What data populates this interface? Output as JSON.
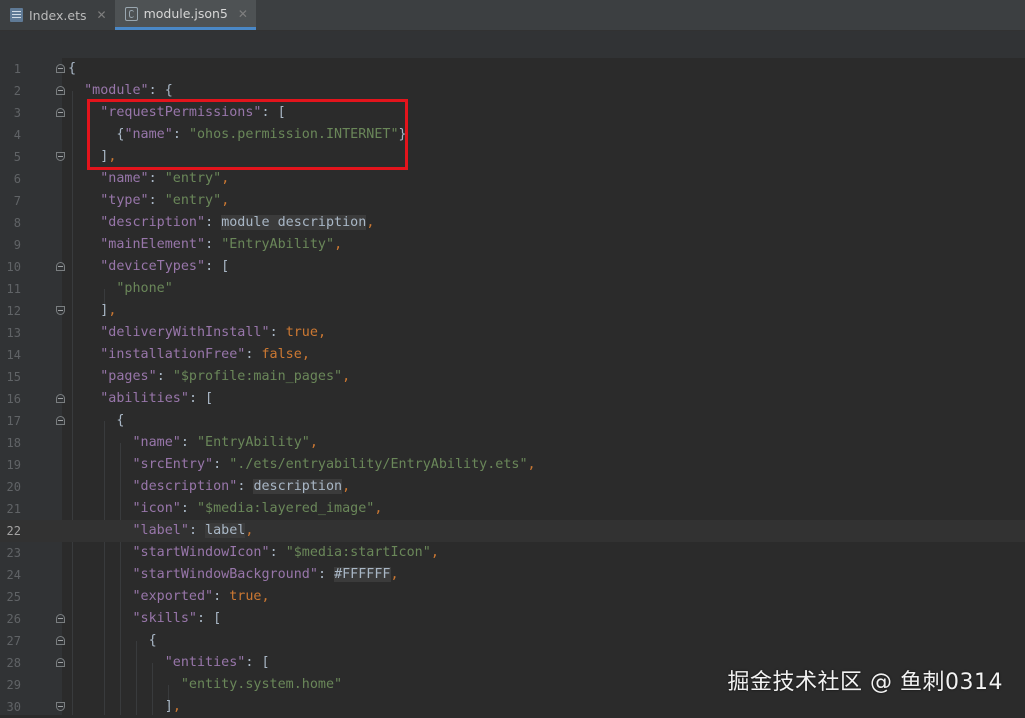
{
  "tabs": [
    {
      "label": "Index.ets",
      "icon": "ets-file-icon",
      "active": false
    },
    {
      "label": "module.json5",
      "icon": "json-file-icon",
      "active": true
    }
  ],
  "tab_close_glyph": "✕",
  "current_line": 22,
  "watermark": "掘金技术社区 @ 鱼刺0314",
  "highlight_color": "#e3141c",
  "lines": [
    {
      "n": "1"
    },
    {
      "n": "2"
    },
    {
      "n": "3"
    },
    {
      "n": "4"
    },
    {
      "n": "5"
    },
    {
      "n": "6"
    },
    {
      "n": "7"
    },
    {
      "n": "8"
    },
    {
      "n": "9"
    },
    {
      "n": "10"
    },
    {
      "n": "11"
    },
    {
      "n": "12"
    },
    {
      "n": "13"
    },
    {
      "n": "14"
    },
    {
      "n": "15"
    },
    {
      "n": "16"
    },
    {
      "n": "17"
    },
    {
      "n": "18"
    },
    {
      "n": "19"
    },
    {
      "n": "20"
    },
    {
      "n": "21"
    },
    {
      "n": "22"
    },
    {
      "n": "23"
    },
    {
      "n": "24"
    },
    {
      "n": "25"
    },
    {
      "n": "26"
    },
    {
      "n": "27"
    },
    {
      "n": "28"
    },
    {
      "n": "29"
    },
    {
      "n": "30"
    }
  ],
  "code": {
    "l1_brace": "{",
    "l2_key": "\"module\"",
    "l3_key": "\"requestPermissions\"",
    "l4_key": "\"name\"",
    "l4_val": "\"ohos.permission.INTERNET\"",
    "l6_key": "\"name\"",
    "l6_val": "\"entry\"",
    "l7_key": "\"type\"",
    "l7_val": "\"entry\"",
    "l8_key": "\"description\"",
    "l8_val": "module description",
    "l9_key": "\"mainElement\"",
    "l9_val": "\"EntryAbility\"",
    "l10_key": "\"deviceTypes\"",
    "l11_val": "\"phone\"",
    "l13_key": "\"deliveryWithInstall\"",
    "l13_val": "true",
    "l14_key": "\"installationFree\"",
    "l14_val": "false",
    "l15_key": "\"pages\"",
    "l15_val": "\"$profile:main_pages\"",
    "l16_key": "\"abilities\"",
    "l18_key": "\"name\"",
    "l18_val": "\"EntryAbility\"",
    "l19_key": "\"srcEntry\"",
    "l19_val": "\"./ets/entryability/EntryAbility.ets\"",
    "l20_key": "\"description\"",
    "l20_val": "description",
    "l21_key": "\"icon\"",
    "l21_val": "\"$media:layered_image\"",
    "l22_key": "\"label\"",
    "l22_val": "label",
    "l23_key": "\"startWindowIcon\"",
    "l23_val": "\"$media:startIcon\"",
    "l24_key": "\"startWindowBackground\"",
    "l24_val": "#FFFFFF",
    "l25_key": "\"exported\"",
    "l25_val": "true",
    "l26_key": "\"skills\"",
    "l28_key": "\"entities\"",
    "l29_val": "\"entity.system.home\""
  }
}
